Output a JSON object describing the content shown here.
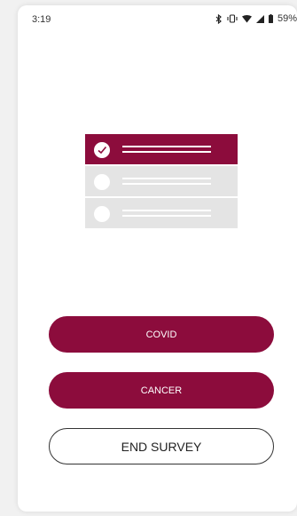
{
  "status_bar": {
    "time": "3:19",
    "battery_percent": "59%",
    "icons": [
      "bluetooth-icon",
      "vibrate-icon",
      "wifi-icon",
      "signal-icon",
      "battery-icon"
    ]
  },
  "illustration": {
    "rows": [
      {
        "selected": true
      },
      {
        "selected": false
      },
      {
        "selected": false
      }
    ]
  },
  "buttons": {
    "covid_label": "COVID",
    "cancer_label": "CANCER",
    "end_survey_label": "END SURVEY"
  },
  "colors": {
    "accent": "#8c0c3c",
    "row_inactive": "#e4e4e4",
    "background": "#ffffff"
  }
}
